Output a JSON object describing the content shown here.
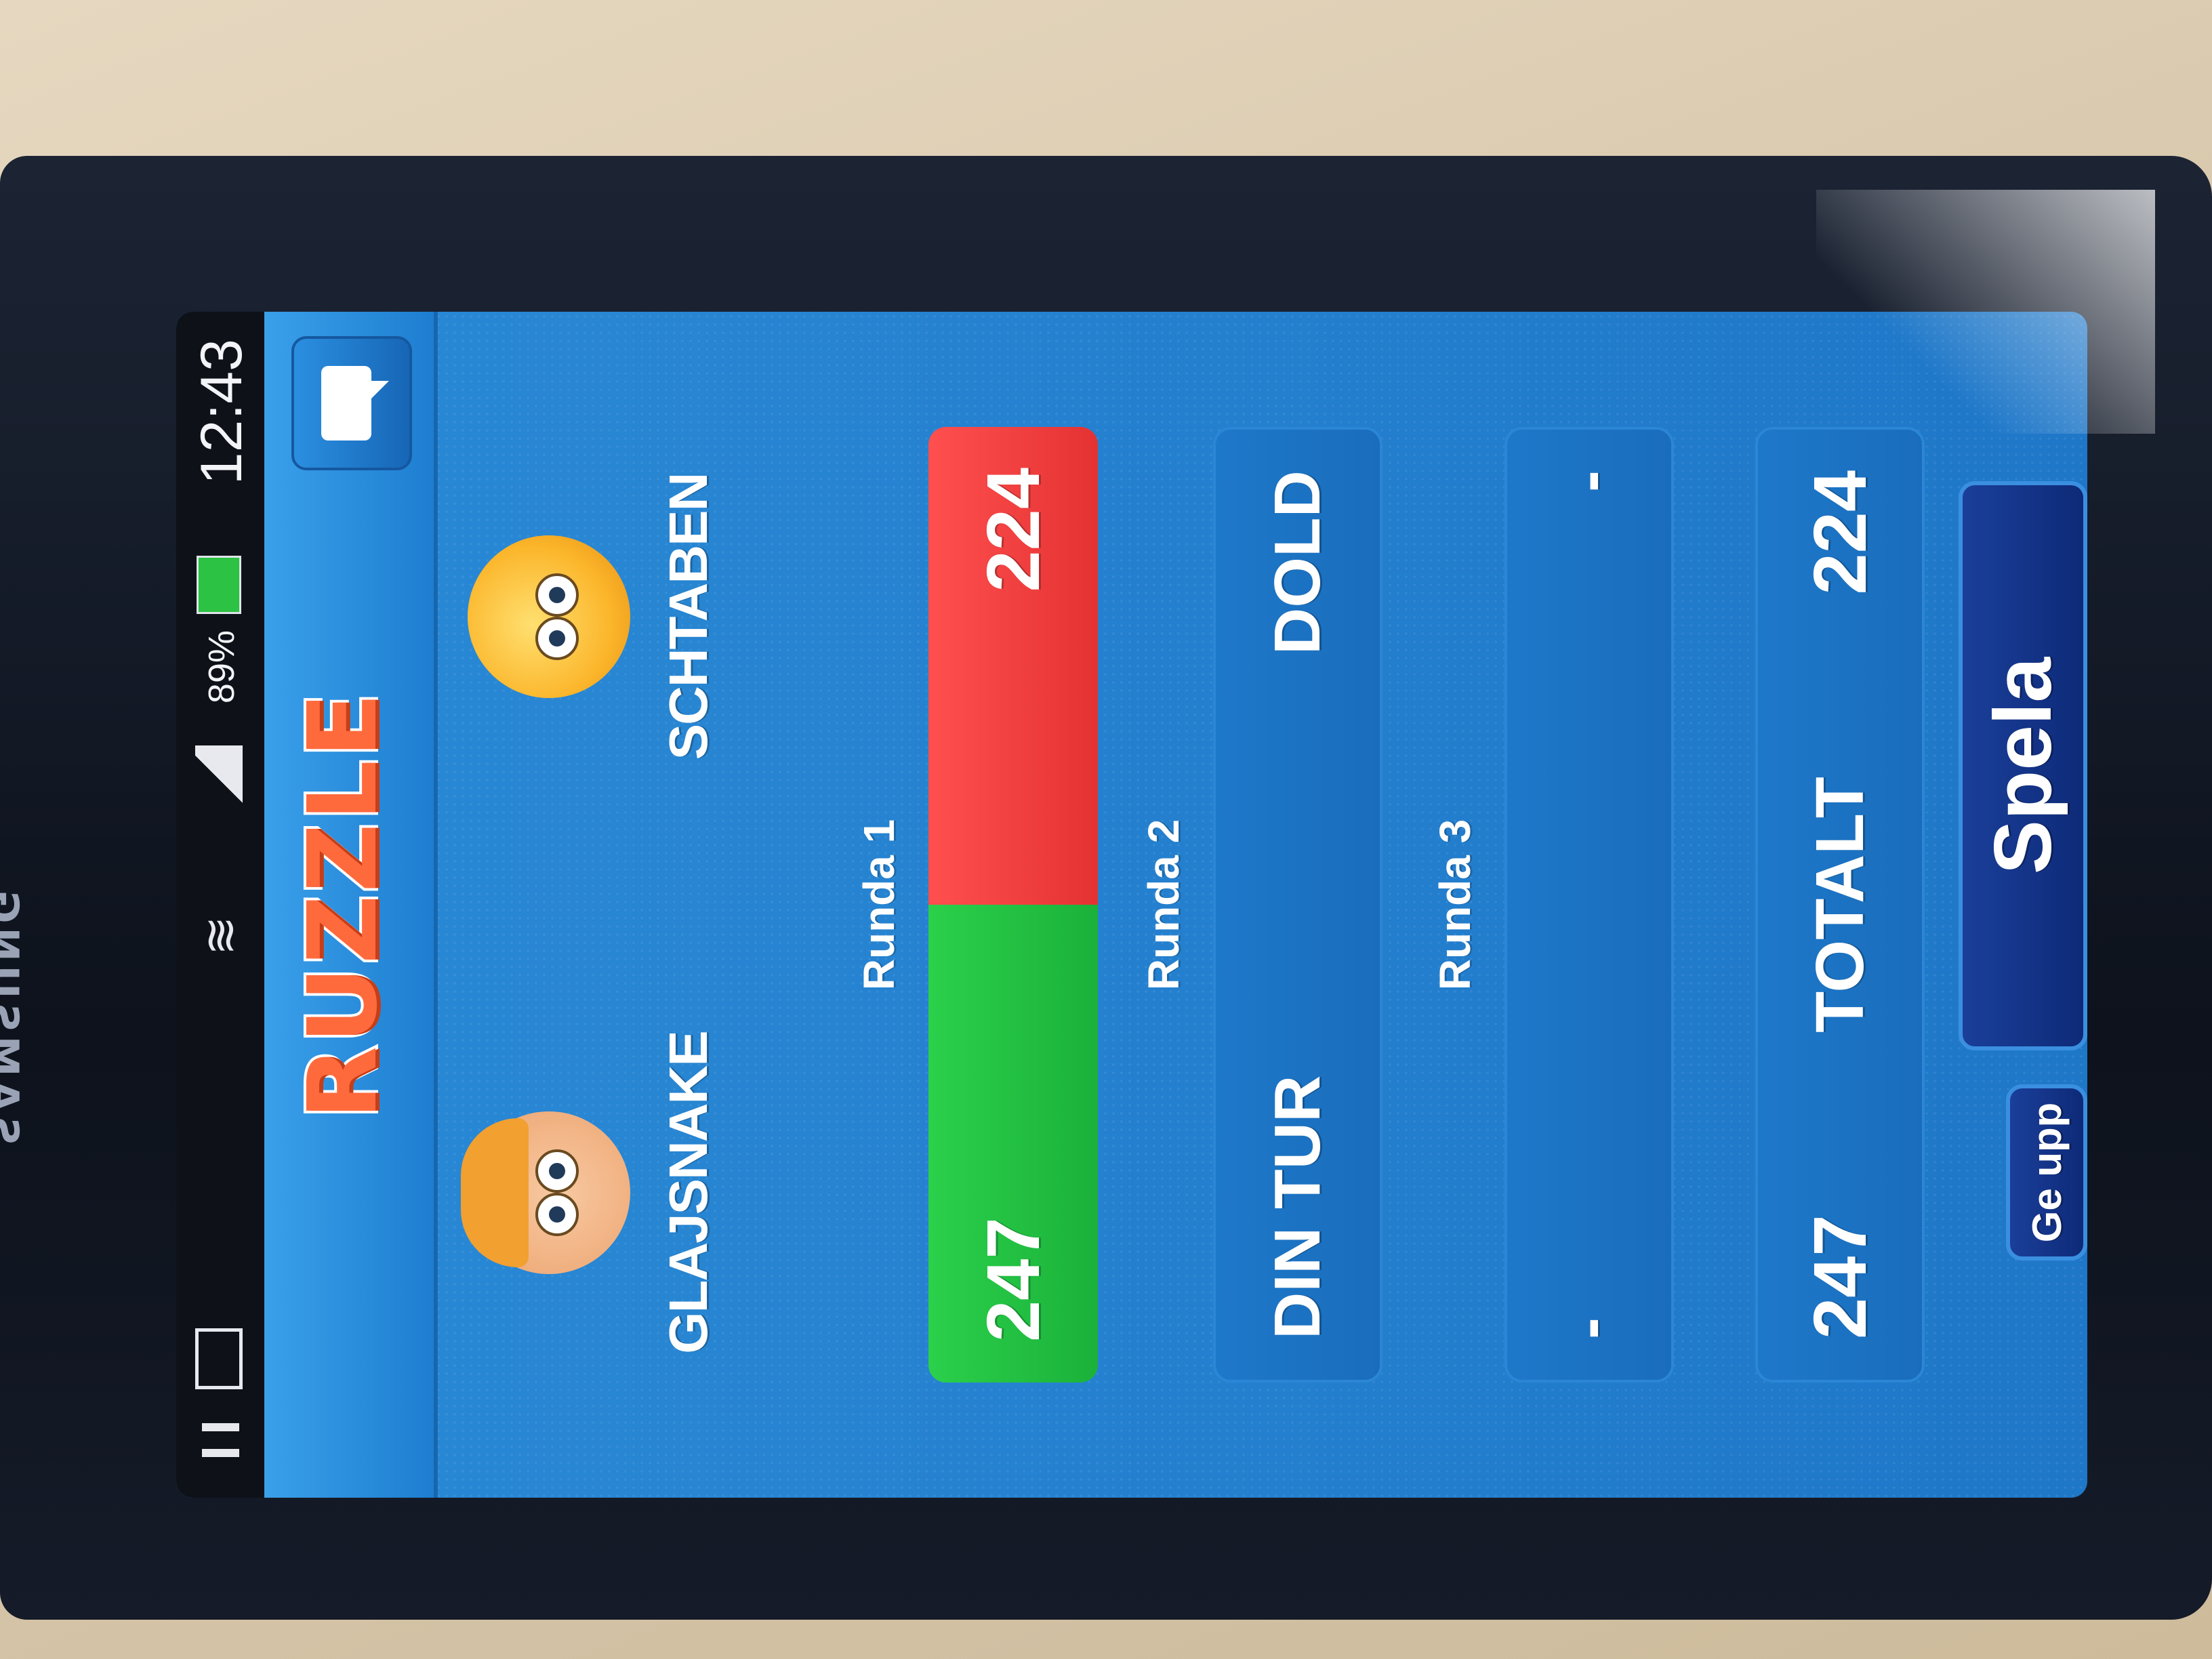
{
  "device": {
    "brand": "SAMSUNG"
  },
  "status_bar": {
    "time": "12:43",
    "battery_percent": "89%"
  },
  "app": {
    "logo": "RUZZLE"
  },
  "players": {
    "left": {
      "name": "GLAJSNAKE"
    },
    "right": {
      "name": "SCHTABEN"
    }
  },
  "rounds": [
    {
      "label": "Runda 1",
      "left": "247",
      "right": "224"
    },
    {
      "label": "Runda 2",
      "left": "DIN TUR",
      "right": "DOLD"
    },
    {
      "label": "Runda 3",
      "left": "-",
      "right": "-"
    }
  ],
  "total": {
    "label": "TOTALT",
    "left": "247",
    "right": "224"
  },
  "buttons": {
    "give_up": "Ge upp",
    "play": "Spela"
  },
  "colors": {
    "round1_left": "#1bb13a",
    "round1_right": "#e43232",
    "screen_bg": "#1f77c8",
    "button": "#0e2a78"
  },
  "icons": [
    "chat-bubble-icon",
    "mail-icon",
    "pause-icon",
    "wifi-icon",
    "signal-icon",
    "battery-icon"
  ]
}
